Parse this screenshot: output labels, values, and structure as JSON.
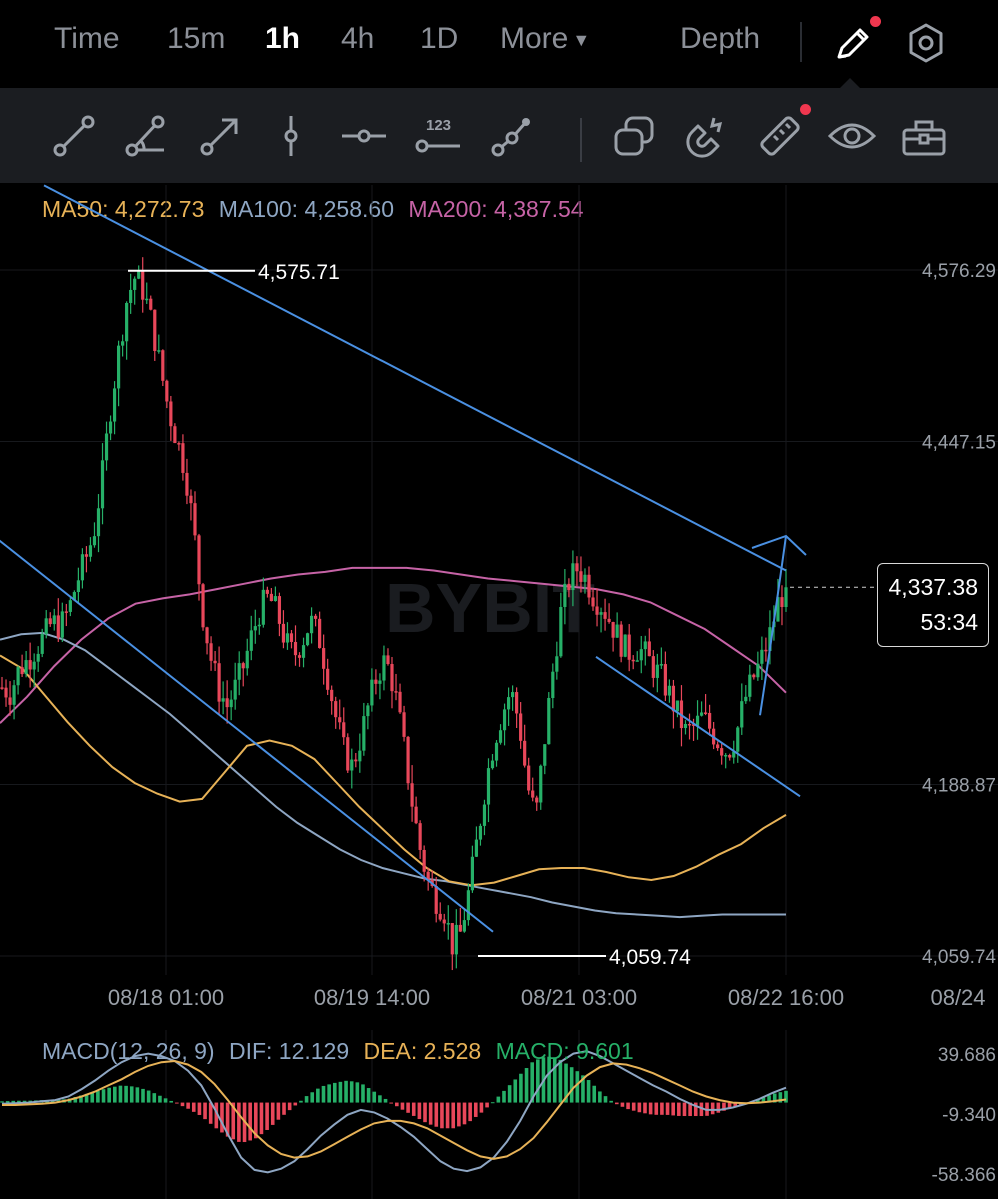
{
  "tabs": {
    "items": [
      {
        "label": "Time"
      },
      {
        "label": "15m"
      },
      {
        "label": "1h",
        "active": true
      },
      {
        "label": "4h"
      },
      {
        "label": "1D"
      },
      {
        "label": "More"
      },
      {
        "label": "Depth"
      }
    ]
  },
  "toolbar_icons": [
    "trend-line-icon",
    "angle-line-icon",
    "arrow-line-icon",
    "vertical-line-icon",
    "horizontal-ray-icon",
    "price-label-icon",
    "path-icon",
    "layers-icon",
    "magnet-icon",
    "ruler-icon",
    "eye-icon",
    "toolbox-icon"
  ],
  "top_icons": [
    "pencil-icon",
    "settings-icon"
  ],
  "colors": {
    "up": "#26b068",
    "down": "#e8475a",
    "ma50": "#e7b257",
    "ma100": "#8ea6c3",
    "ma200": "#c663a6",
    "drawing": "#4a90e2",
    "notification": "#f0374f"
  },
  "ma_legend": {
    "ma50": "MA50: 4,272.73",
    "ma100": "MA100: 4,258.60",
    "ma200": "MA200: 4,387.54"
  },
  "macd_legend": {
    "title": "MACD(12, 26, 9)",
    "dif": "DIF: 12.129",
    "dea": "DEA: 2.528",
    "macd": "MACD: 9.601"
  },
  "watermark": "BYBIT",
  "current_price": {
    "price": "4,337.38",
    "countdown": "53:34"
  },
  "chart_data": {
    "type": "candlestick",
    "interval": "1h",
    "y_axis_ticks": [
      {
        "value": 4576.29,
        "label": "4,576.29"
      },
      {
        "value": 4447.15,
        "label": "4,447.15"
      },
      {
        "value": 4188.87,
        "label": "4,188.87"
      },
      {
        "value": 4059.74,
        "label": "4,059.74"
      }
    ],
    "x_axis_ticks": [
      "08/18 01:00",
      "08/19 14:00",
      "08/21 03:00",
      "08/22 16:00",
      "08/24"
    ],
    "annotations": {
      "high": {
        "value": 4575.71,
        "label": "4,575.71"
      },
      "low": {
        "value": 4059.74,
        "label": "4,059.74"
      }
    },
    "key_points": [
      4262,
      4258,
      4275,
      4282,
      4291,
      4300,
      4311,
      4308,
      4320,
      4342,
      4358,
      4378,
      4420,
      4472,
      4515,
      4555,
      4572,
      4560,
      4535,
      4502,
      4470,
      4448,
      4425,
      4380,
      4320,
      4285,
      4260,
      4248,
      4262,
      4279,
      4302,
      4322,
      4330,
      4318,
      4296,
      4286,
      4297,
      4312,
      4300,
      4272,
      4240,
      4214,
      4202,
      4224,
      4250,
      4272,
      4283,
      4262,
      4225,
      4182,
      4144,
      4117,
      4103,
      4094,
      4068,
      4077,
      4109,
      4148,
      4190,
      4222,
      4243,
      4260,
      4236,
      4188,
      4164,
      4220,
      4272,
      4318,
      4342,
      4352,
      4344,
      4330,
      4323,
      4311,
      4298,
      4288,
      4292,
      4288,
      4278,
      4270,
      4257,
      4242,
      4228,
      4232,
      4240,
      4230,
      4220,
      4213,
      4226,
      4252,
      4268,
      4282,
      4300,
      4325,
      4337.38
    ],
    "ma50_points": [
      4286,
      4276,
      4256,
      4236,
      4218,
      4202,
      4190,
      4182,
      4176,
      4178,
      4198,
      4218,
      4222,
      4218,
      4208,
      4190,
      4172,
      4156,
      4140,
      4126,
      4116,
      4113,
      4115,
      4120,
      4125,
      4126,
      4126,
      4123,
      4119,
      4117,
      4120,
      4127,
      4136,
      4144,
      4156,
      4166
    ],
    "ma100_points": [
      4298,
      4302,
      4303,
      4298,
      4290,
      4278,
      4266,
      4254,
      4242,
      4228,
      4214,
      4200,
      4186,
      4172,
      4160,
      4150,
      4140,
      4132,
      4126,
      4122,
      4118,
      4116,
      4113,
      4110,
      4107,
      4104,
      4100,
      4097,
      4094,
      4092,
      4091,
      4090,
      4089,
      4090,
      4091,
      4091,
      4091,
      4091
    ],
    "ma200_points": [
      4235,
      4255,
      4278,
      4298,
      4314,
      4325,
      4329,
      4332,
      4336,
      4340,
      4344,
      4347,
      4349,
      4352,
      4352,
      4352,
      4350,
      4347,
      4344,
      4342,
      4340,
      4338,
      4336,
      4332,
      4326,
      4316,
      4306,
      4292,
      4278,
      4258
    ],
    "drawings": [
      {
        "type": "upper-channel-line",
        "from": [
          "08/17",
          4640
        ],
        "to": [
          "08/22 16:00",
          4350
        ]
      },
      {
        "type": "lower-channel-line",
        "from": [
          "08/16",
          4420
        ],
        "to": [
          "08/20 08:00",
          4078
        ]
      },
      {
        "type": "inner-channel-line",
        "from": [
          "08/21 06:00",
          4285
        ],
        "to": [
          "08/22 20:00",
          4180
        ]
      },
      {
        "type": "up-arrow",
        "from": [
          "08/22 12:00",
          4241
        ],
        "to": [
          "08/22 16:00",
          4376
        ]
      }
    ],
    "macd": {
      "y_axis_ticks": [
        {
          "value": 39.686,
          "label": "39.686"
        },
        {
          "value": -9.34,
          "label": "-9.340"
        },
        {
          "value": -58.366,
          "label": "-58.366"
        }
      ],
      "dif": [
        -1,
        -0.5,
        0,
        1,
        2,
        5,
        11,
        18,
        26,
        33,
        38,
        40,
        38,
        34,
        26,
        14,
        -5,
        -26,
        -45,
        -55,
        -57,
        -54,
        -48,
        -38,
        -27,
        -18,
        -10,
        -6,
        -8,
        -13,
        -20,
        -28,
        -38,
        -48,
        -54,
        -56,
        -53,
        -45,
        -32,
        -15,
        5,
        22,
        33,
        40,
        42,
        38,
        32,
        26,
        20,
        14,
        9,
        3,
        -2,
        -6,
        -6,
        -4,
        -1,
        3,
        8,
        12.129
      ],
      "dea": [
        -2,
        -2,
        -1.5,
        -1,
        0,
        2,
        5,
        9,
        14,
        19,
        25,
        30,
        33,
        34,
        31,
        25,
        15,
        2,
        -12,
        -25,
        -35,
        -42,
        -45,
        -44,
        -40,
        -34,
        -28,
        -22,
        -17,
        -15,
        -15,
        -17,
        -21,
        -27,
        -33,
        -39,
        -44,
        -46,
        -44,
        -38,
        -29,
        -16,
        -2,
        12,
        22,
        29,
        32,
        31,
        28,
        24,
        19,
        14,
        9,
        5,
        2,
        0,
        -0.5,
        0,
        1,
        2.528
      ],
      "hist": [
        1,
        1.5,
        1.5,
        2,
        2,
        3,
        6,
        9,
        12,
        14,
        13,
        10,
        5,
        0,
        -5,
        -11,
        -20,
        -28,
        -33,
        -30,
        -22,
        -12,
        -3,
        6,
        13,
        16,
        18,
        16,
        9,
        2,
        -5,
        -11,
        -17,
        -21,
        -21,
        -17,
        -9,
        1,
        12,
        23,
        34,
        38,
        35,
        28,
        20,
        9,
        0,
        -5,
        -8,
        -10,
        -10,
        -11,
        -11,
        -11,
        -8,
        -4,
        -0.5,
        3,
        7,
        9.601
      ]
    }
  }
}
